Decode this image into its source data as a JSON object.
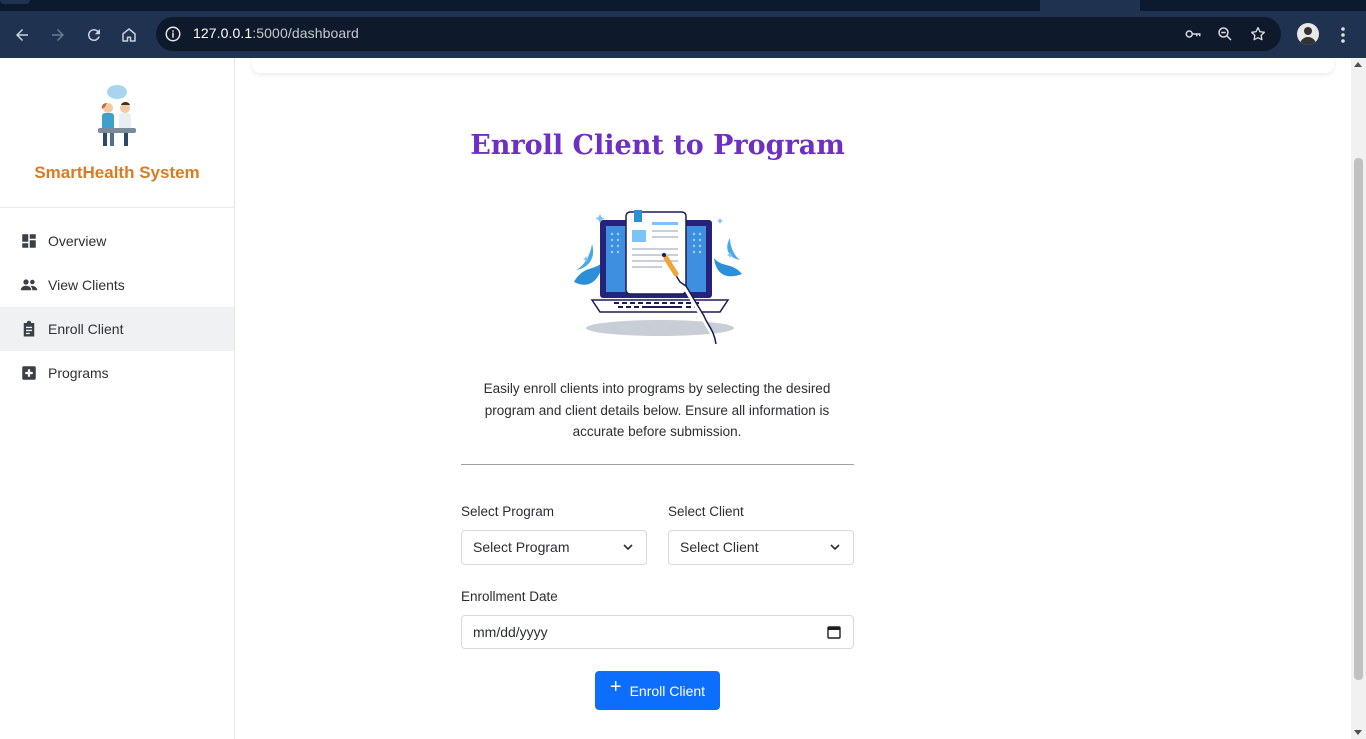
{
  "browser": {
    "url_host": "127.0.0.1",
    "url_rest": ":5000/dashboard"
  },
  "sidebar": {
    "brand": "SmartHealth System",
    "items": [
      {
        "label": "Overview",
        "icon": "dashboard-icon"
      },
      {
        "label": "View Clients",
        "icon": "people-icon"
      },
      {
        "label": "Enroll Client",
        "icon": "clipboard-icon",
        "active": true
      },
      {
        "label": "Programs",
        "icon": "medical-plus-icon"
      }
    ]
  },
  "main": {
    "title": "Enroll Client to Program",
    "description": "Easily enroll clients into programs by selecting the desired program and client details below. Ensure all information is accurate before submission.",
    "form": {
      "program_label": "Select Program",
      "program_value": "Select Program",
      "client_label": "Select Client",
      "client_value": "Select Client",
      "date_label": "Enrollment Date",
      "date_placeholder": "mm/dd/yyyy",
      "submit_label": "Enroll Client"
    }
  },
  "colors": {
    "title": "#6d2fc4",
    "brand": "#d97b22",
    "primary_button": "#0d6efd"
  }
}
